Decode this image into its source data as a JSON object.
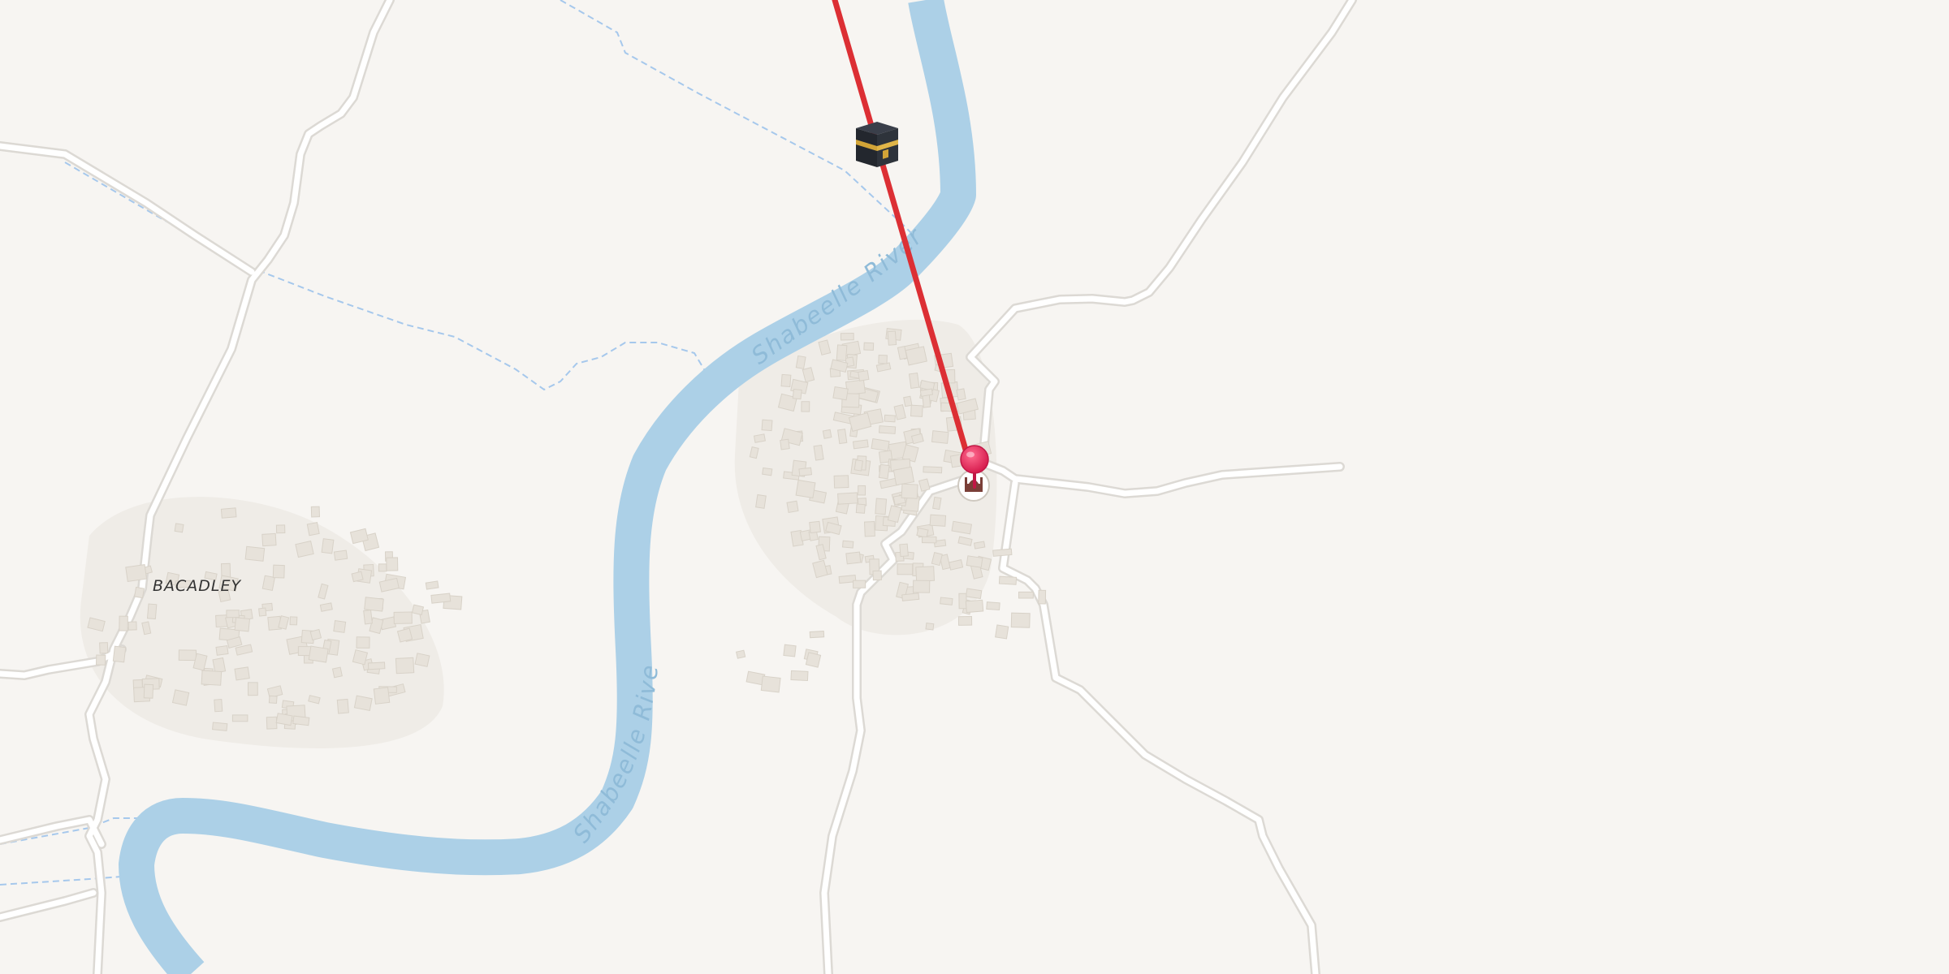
{
  "map": {
    "type": "street map",
    "colors": {
      "land": "#f7f5f2",
      "river": "#acd0e7",
      "river_label": "#7fb2d6",
      "road_casing": "#dcd9d4",
      "road_fill": "#ffffff",
      "boundary": "#a6c8ec",
      "buildings": "#e7e2da",
      "settlement_area": "#efece7",
      "route_line": "#dc2f34",
      "pin": "#e8245a"
    },
    "labels": {
      "village": "BACADLEY",
      "river_upper": "Shabeelle River",
      "river_lower": "Shabeelle River"
    },
    "markers": {
      "qibla_icon": "kaaba-icon",
      "location_pin": "map-pin-icon",
      "mosque_poi": "mosque-icon"
    }
  }
}
